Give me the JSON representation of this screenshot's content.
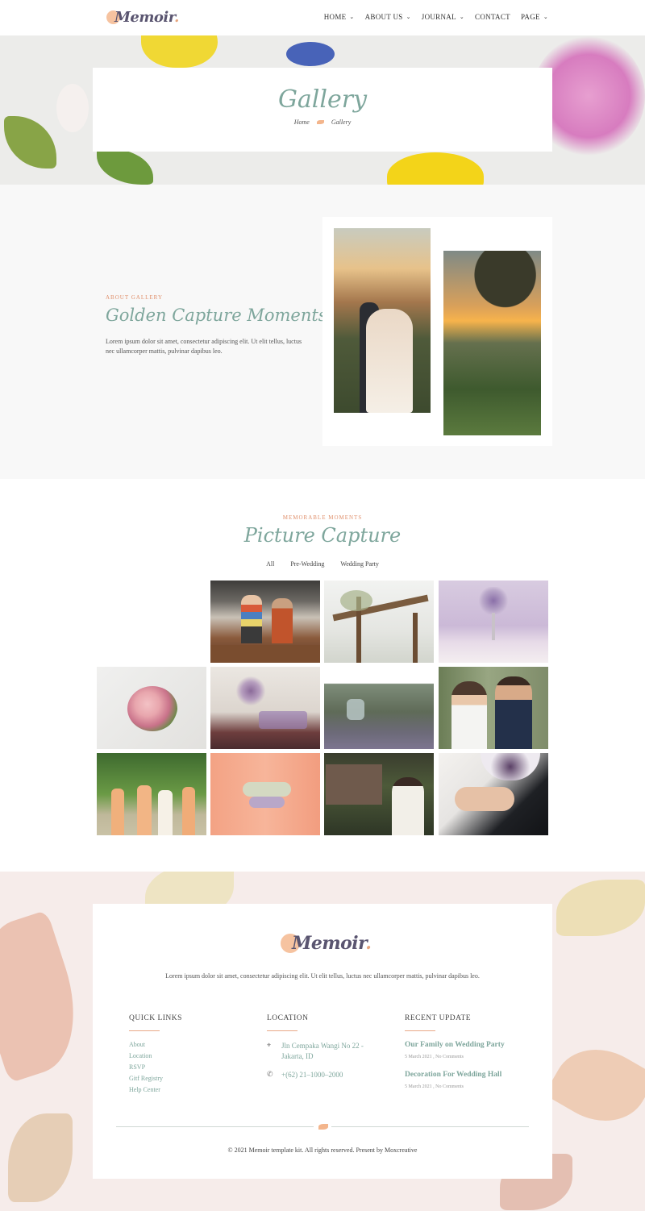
{
  "brand": {
    "name": "Memoir",
    "period": ".",
    "accent": "#7ea69c",
    "peach": "#f6c3a0"
  },
  "nav": [
    {
      "label": "HOME",
      "has_dropdown": true
    },
    {
      "label": "ABOUT US",
      "has_dropdown": true
    },
    {
      "label": "JOURNAL",
      "has_dropdown": true
    },
    {
      "label": "CONTACT",
      "has_dropdown": false
    },
    {
      "label": "PAGE",
      "has_dropdown": true
    }
  ],
  "hero": {
    "title": "Gallery",
    "breadcrumb": {
      "home": "Home",
      "current": "Gallery"
    }
  },
  "about": {
    "kicker": "ABOUT GALLERY",
    "title": "Golden Capture Moments.",
    "text": "Lorem ipsum dolor sit amet, consectetur adipiscing elit. Ut elit tellus, luctus nec ullamcorper mattis, pulvinar dapibus leo."
  },
  "capture": {
    "kicker": "MEMORABLE MOMENTS",
    "title": "Picture Capture",
    "filters": [
      "All",
      "Pre-Wedding",
      "Wedding Party"
    ],
    "images": [
      {
        "name": "couple-cooking-photo"
      },
      {
        "name": "wedding-arch-photo"
      },
      {
        "name": "reception-table-photo"
      },
      {
        "name": "bridal-bouquet-photo"
      },
      {
        "name": "table-setting-photo"
      },
      {
        "name": "hanging-lantern-photo"
      },
      {
        "name": "bride-groom-portrait-photo"
      },
      {
        "name": "bridesmaids-garden-photo"
      },
      {
        "name": "bridesmaids-wrist-corsage-photo"
      },
      {
        "name": "bride-in-veil-photo"
      },
      {
        "name": "ring-exchange-photo"
      }
    ]
  },
  "footer": {
    "description": "Lorem ipsum dolor sit amet, consectetur adipiscing elit. Ut elit tellus, luctus nec ullamcorper mattis, pulvinar dapibus leo.",
    "quick_links": {
      "heading": "QUICK LINKS",
      "items": [
        "About",
        "Location",
        "RSVP",
        "Gitf Registry",
        "Help Center"
      ]
    },
    "location": {
      "heading": "LOCATION",
      "address": "Jln Cempaka Wangi No 22 - Jakarta, ID",
      "phone": "+(62) 21–1000–2000"
    },
    "recent": {
      "heading": "RECENT UPDATE",
      "posts": [
        {
          "title": "Our Family on Wedding Party",
          "date": "5 March 2021",
          "comments": "No Comments"
        },
        {
          "title": "Decoration For Wedding Hall",
          "date": "5 March 2021",
          "comments": "No Comments"
        }
      ]
    },
    "copyright": "© 2021 Memoir template kit. All rights reserved. Present by Moxcreative"
  }
}
